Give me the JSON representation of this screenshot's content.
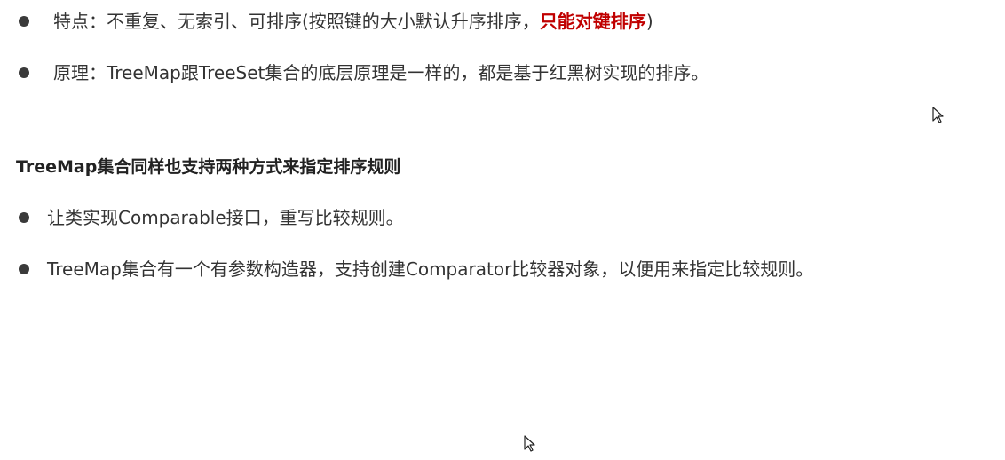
{
  "section1": {
    "items": [
      {
        "prefix": "特点：不重复、无索引、可排序(按照键的大小默认升序排序，",
        "highlight": "只能对键排序",
        "suffix": ")"
      },
      {
        "text": "原理：TreeMap跟TreeSet集合的底层原理是一样的，都是基于红黑树实现的排序。"
      }
    ]
  },
  "section2": {
    "heading": "TreeMap集合同样也支持两种方式来指定排序规则",
    "items": [
      {
        "text": "让类实现Comparable接口，重写比较规则。"
      },
      {
        "text": "TreeMap集合有一个有参数构造器，支持创建Comparator比较器对象，以便用来指定比较规则。"
      }
    ]
  },
  "colors": {
    "text": "#333333",
    "highlight": "#c00000",
    "bullet": "#3a3a3a"
  },
  "icons": {
    "bullet": "filled-circle",
    "cursor": "mouse-pointer-arrow"
  }
}
